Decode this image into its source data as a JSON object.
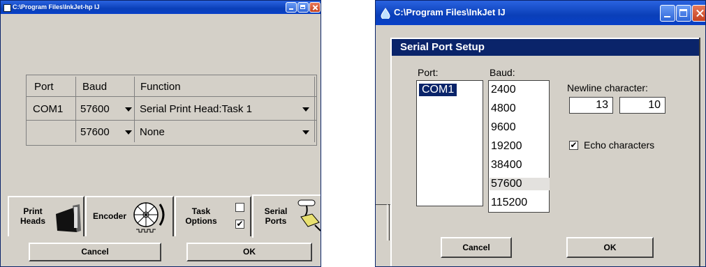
{
  "left_window": {
    "title": "C:\\Program Files\\InkJet-hp   IJ",
    "table": {
      "headers": [
        "Port",
        "Baud",
        "Function"
      ],
      "rows": [
        {
          "port": "COM1",
          "baud": "57600",
          "function": "Serial Print Head:Task 1"
        },
        {
          "port": "",
          "baud": "57600",
          "function": "None"
        }
      ]
    },
    "tabs": {
      "print_heads": {
        "line1": "Print",
        "line2": "Heads"
      },
      "encoder": {
        "label": "Encoder"
      },
      "task_options": {
        "line1": "Task",
        "line2": "Options",
        "checkbox_top": false,
        "checkbox_bottom": true,
        "checkmark": "✔"
      },
      "serial_ports": {
        "line1": "Serial",
        "line2": "Ports"
      }
    },
    "buttons": {
      "cancel": "Cancel",
      "ok": "OK"
    }
  },
  "right_window": {
    "title": "C:\\Program Files\\InkJet   IJ",
    "dialog_title": "Serial Port Setup",
    "port_label": "Port:",
    "ports": [
      "COM1"
    ],
    "baud_label": "Baud:",
    "bauds": [
      "2400",
      "4800",
      "9600",
      "19200",
      "38400",
      "57600",
      "115200"
    ],
    "selected_baud": "57600",
    "newline_label": "Newline character:",
    "newline_values": [
      "13",
      "10"
    ],
    "echo_label": "Echo characters",
    "echo_checked": true,
    "checkmark": "✔",
    "buttons": {
      "cancel": "Cancel",
      "ok": "OK"
    }
  },
  "colors": {
    "titlebar": "#0a3fb8",
    "dialog_title_bg": "#0a246a",
    "face": "#d4d0c8"
  }
}
